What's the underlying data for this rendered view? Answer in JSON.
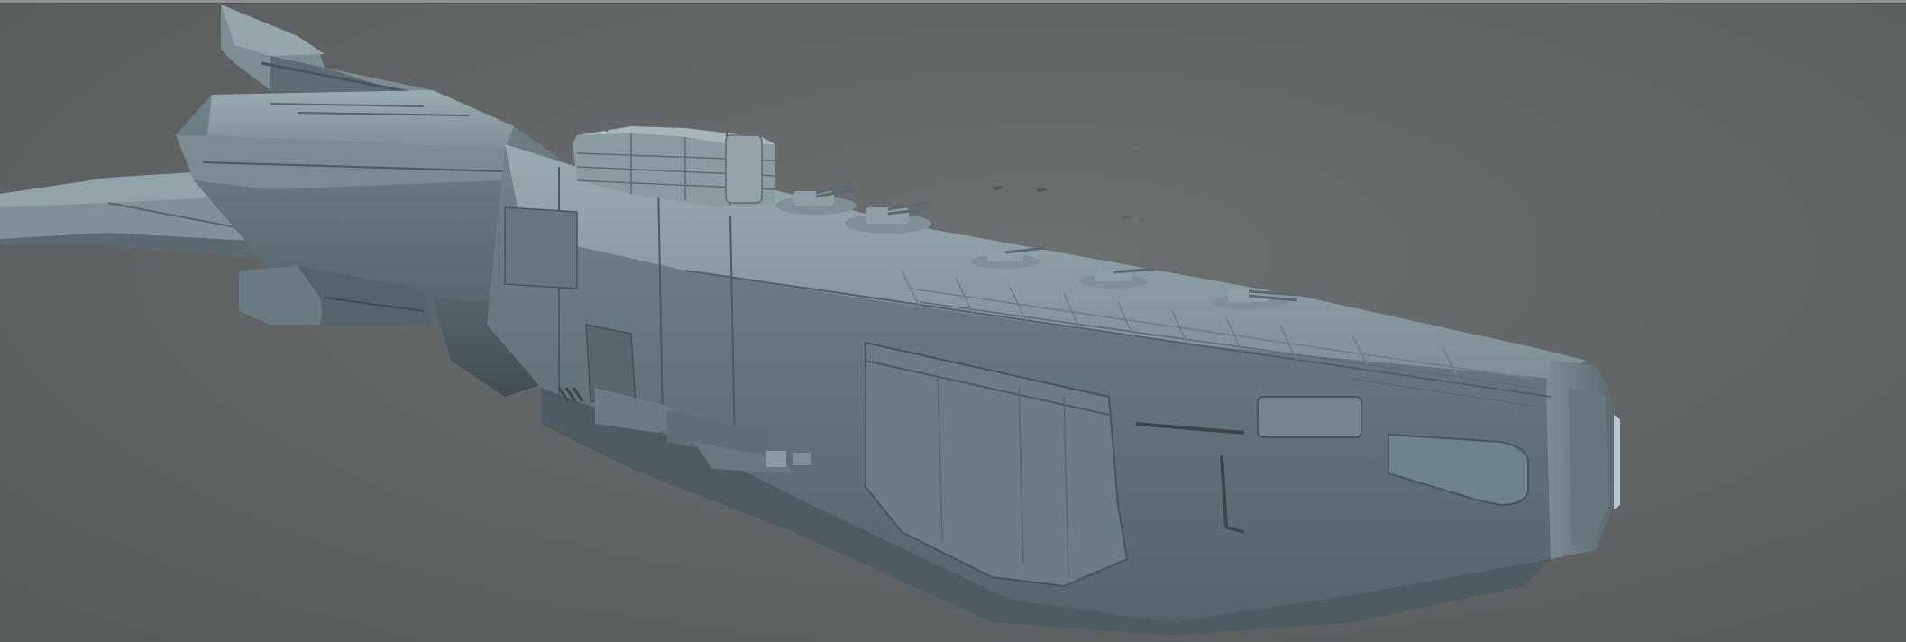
{
  "scene": {
    "subject": "starship-render",
    "background_color": "#636767",
    "hull_color": "#6f7f84",
    "hull_dark": "#4a5459",
    "hull_light": "#8d9ea3"
  }
}
